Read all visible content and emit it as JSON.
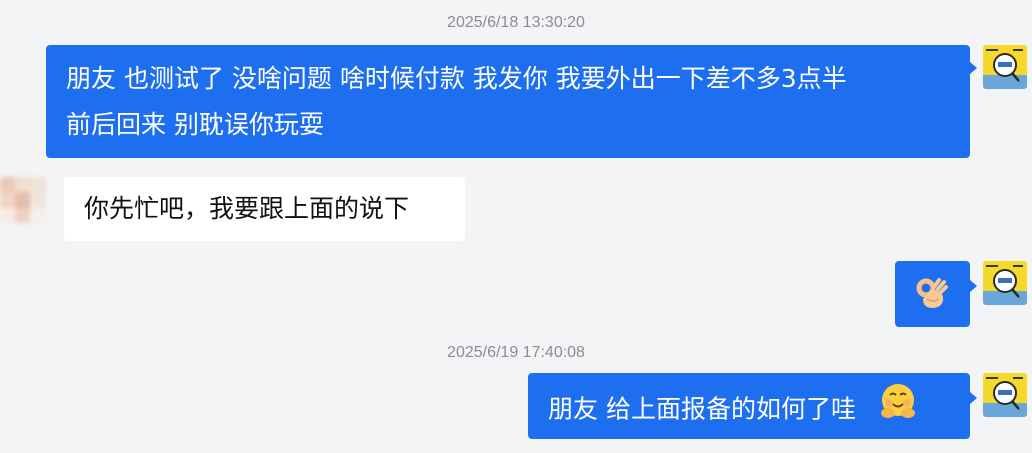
{
  "chat": {
    "messages": [
      {
        "kind": "timestamp",
        "text": "2025/6/18 13:30:20"
      },
      {
        "kind": "outgoing",
        "lines": [
          "朋友 也测试了  没啥问题 啥时候付款  我发你 我要外出一下差不多3点半",
          "前后回来  别耽误你玩耍"
        ]
      },
      {
        "kind": "incoming",
        "text": "你先忙吧，我要跟上面的说下"
      },
      {
        "kind": "outgoing",
        "emoji": "ok-hand-emoji"
      },
      {
        "kind": "timestamp",
        "text": "2025/6/19 17:40:08"
      },
      {
        "kind": "outgoing",
        "text": "朋友 给上面报备的如何了哇",
        "emoji": "hugging-face-emoji"
      }
    ]
  },
  "colors": {
    "background": "#f3f4f6",
    "outgoing_bubble": "#1e6ff0",
    "incoming_bubble": "#ffffff",
    "timestamp_text": "#8a8d93"
  }
}
